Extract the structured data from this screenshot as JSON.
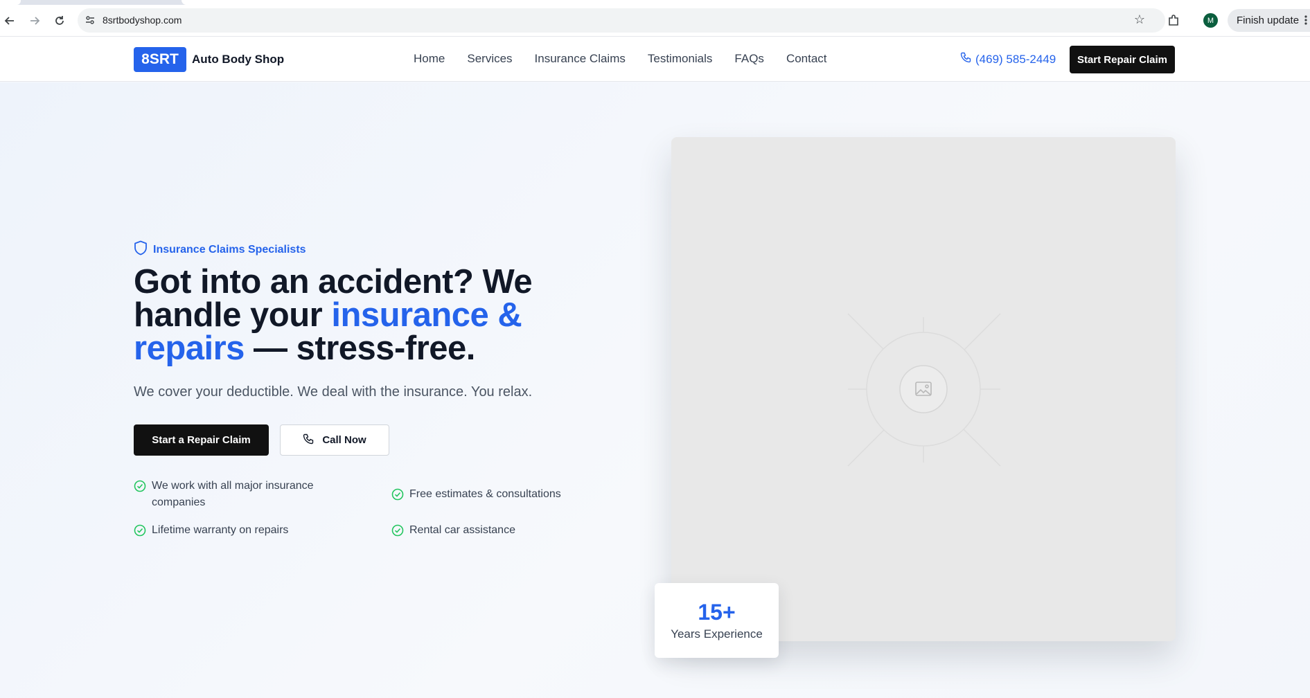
{
  "browser": {
    "url": "8srtbodyshop.com",
    "avatar_initial": "M",
    "update_label": "Finish update"
  },
  "header": {
    "logo_mark": "8SRT",
    "logo_text": "Auto Body Shop",
    "nav": [
      "Home",
      "Services",
      "Insurance Claims",
      "Testimonials",
      "FAQs",
      "Contact"
    ],
    "phone": "(469) 585-2449",
    "cta": "Start Repair Claim"
  },
  "hero": {
    "eyebrow": "Insurance Claims Specialists",
    "headline_part1": "Got into an accident? We handle your ",
    "headline_accent": "insurance & repairs",
    "headline_part2": " — stress-free.",
    "subhead": "We cover your deductible. We deal with the insurance. You relax.",
    "primary_button": "Start a Repair Claim",
    "secondary_button": "Call Now",
    "features": [
      "We work with all major insurance companies",
      "Free estimates & consultations",
      "Lifetime warranty on repairs",
      "Rental car assistance"
    ],
    "stat_value": "15+",
    "stat_label": "Years Experience"
  },
  "colors": {
    "accent": "#2563eb",
    "dark": "#111111",
    "check": "#22c55e"
  },
  "icons": {
    "back": "back-arrow-icon",
    "forward": "forward-arrow-icon",
    "reload": "reload-icon",
    "site_info": "site-info-icon",
    "bookmark": "star-icon",
    "extensions": "extensions-icon",
    "menu": "kebab-menu-icon",
    "phone": "phone-icon",
    "shield": "shield-icon",
    "check": "check-circle-icon",
    "image": "image-placeholder-icon"
  }
}
